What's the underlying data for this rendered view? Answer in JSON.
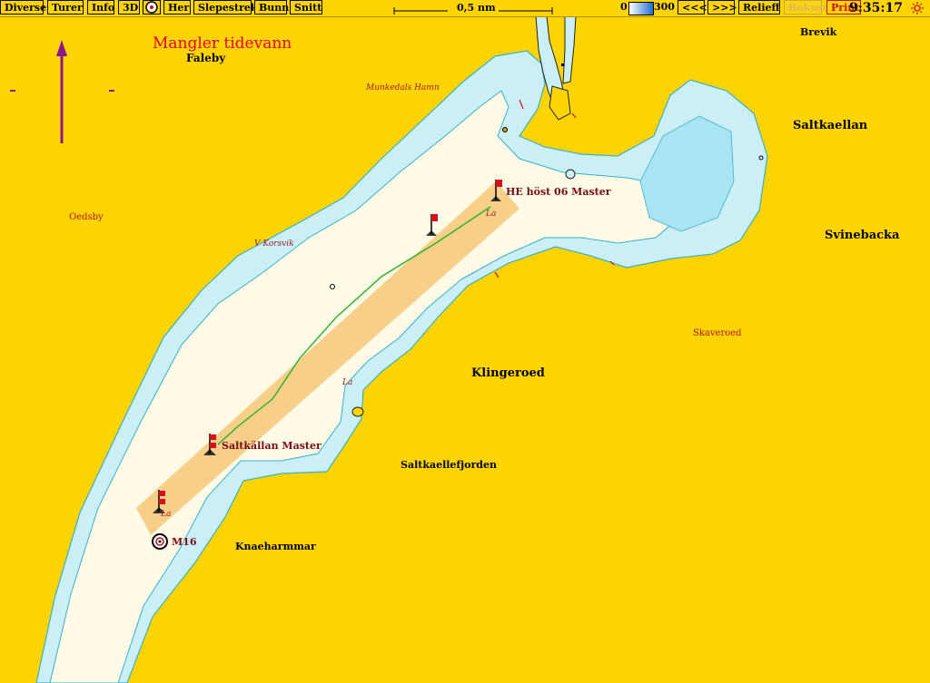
{
  "toolbar": {
    "buttons": [
      "Diverse",
      "Turer",
      "Info",
      "3D",
      "Her",
      "Slepestrek",
      "Bunn",
      "Snitt"
    ],
    "scale_label": "0,5 nm",
    "depth_min": "0",
    "depth_max": "300",
    "prev": "<<<",
    "next": ">>>",
    "relief": "Relieff",
    "bokser": "Bokser",
    "print": "Print",
    "clock": "9:35:17"
  },
  "map": {
    "warning": "Mangler tidevann",
    "places": {
      "faleby": "Faleby",
      "brevik": "Brevik",
      "saltkaellan": "Saltkaellan",
      "svinebacka": "Svinebacka",
      "klingeroed": "Klingeroed",
      "saltkaellefjorden": "Saltkaellefjorden",
      "knaeharmmar": "Knaeharmmar"
    },
    "small_places": {
      "munkedals_hamn": "Munkedals Hamn",
      "oedsby": "Oedsby",
      "v_korsvik": "V Korsvik",
      "skaveroed": "Skaveroed"
    },
    "water_labels": [
      "La",
      "La",
      "La"
    ],
    "routes": {
      "he_host": "HE höst 06 Master",
      "saltkallan": "Saltkällan Master"
    },
    "marker": "M16"
  },
  "colors": {
    "land": "#ffd400",
    "shallow": "#cbeff7",
    "deep": "#fffbe6",
    "route_area": "#f6c777",
    "route_line": "#28b028",
    "flag": "#d6101c",
    "north_arrow": "#8a1a8a"
  }
}
